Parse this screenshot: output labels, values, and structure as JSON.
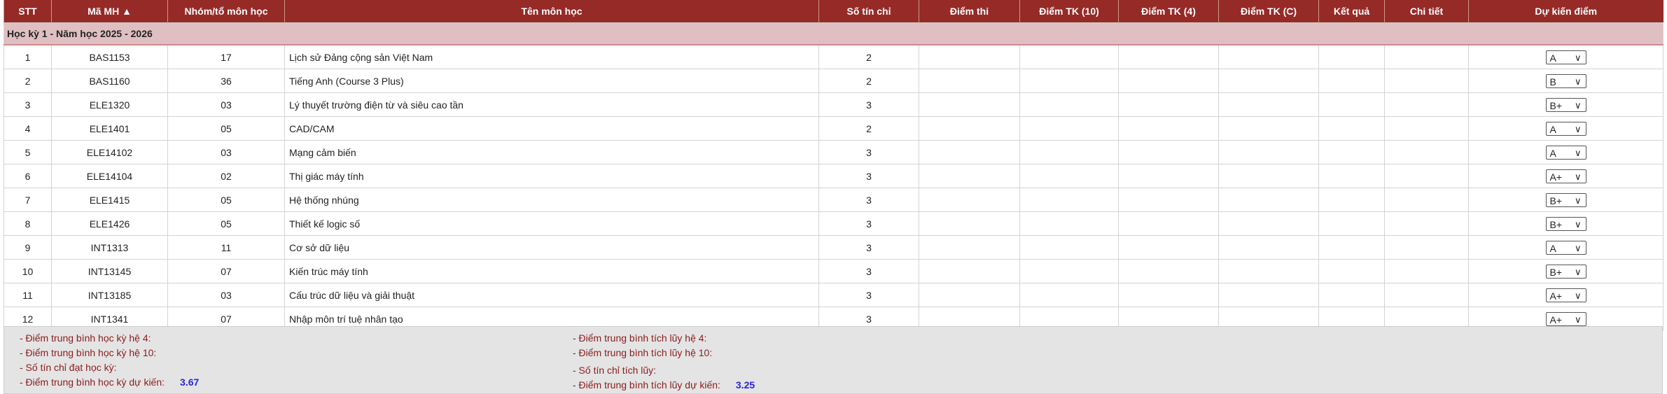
{
  "table": {
    "headers": [
      "STT",
      "Mã MH ▲",
      "Nhóm/tổ môn học",
      "Tên môn học",
      "Số tín chỉ",
      "Điểm thi",
      "Điểm TK (10)",
      "Điểm TK (4)",
      "Điểm TK (C)",
      "Kết quả",
      "Chi tiết",
      "Dự kiến điểm"
    ],
    "group_label": "Học kỳ 1 - Năm học 2025 - 2026",
    "rows": [
      {
        "stt": "1",
        "code": "BAS1153",
        "group": "17",
        "name": "Lịch sử Đảng cộng sản Việt Nam",
        "credits": "2",
        "predicted": "A"
      },
      {
        "stt": "2",
        "code": "BAS1160",
        "group": "36",
        "name": "Tiếng Anh (Course 3 Plus)",
        "credits": "2",
        "predicted": "B"
      },
      {
        "stt": "3",
        "code": "ELE1320",
        "group": "03",
        "name": "Lý thuyết trường điện từ và siêu cao tần",
        "credits": "3",
        "predicted": "B+"
      },
      {
        "stt": "4",
        "code": "ELE1401",
        "group": "05",
        "name": "CAD/CAM",
        "credits": "2",
        "predicted": "A"
      },
      {
        "stt": "5",
        "code": "ELE14102",
        "group": "03",
        "name": "Mạng cảm biến",
        "credits": "3",
        "predicted": "A"
      },
      {
        "stt": "6",
        "code": "ELE14104",
        "group": "02",
        "name": "Thị giác máy tính",
        "credits": "3",
        "predicted": "A+"
      },
      {
        "stt": "7",
        "code": "ELE1415",
        "group": "05",
        "name": "Hệ thống nhúng",
        "credits": "3",
        "predicted": "B+"
      },
      {
        "stt": "8",
        "code": "ELE1426",
        "group": "05",
        "name": "Thiết kế logic số",
        "credits": "3",
        "predicted": "B+"
      },
      {
        "stt": "9",
        "code": "INT1313",
        "group": "11",
        "name": "Cơ sở dữ liệu",
        "credits": "3",
        "predicted": "A"
      },
      {
        "stt": "10",
        "code": "INT13145",
        "group": "07",
        "name": "Kiến trúc máy tính",
        "credits": "3",
        "predicted": "B+"
      },
      {
        "stt": "11",
        "code": "INT13185",
        "group": "03",
        "name": "Cấu trúc dữ liệu và giải thuật",
        "credits": "3",
        "predicted": "A+"
      },
      {
        "stt": "12",
        "code": "INT1341",
        "group": "07",
        "name": "Nhập môn trí tuệ nhân tạo",
        "credits": "3",
        "predicted": "A+"
      }
    ]
  },
  "summary": {
    "left": [
      {
        "label": "- Điểm trung bình học kỳ hệ 4:",
        "value": ""
      },
      {
        "label": "- Điểm trung bình học kỳ hệ 10:",
        "value": ""
      },
      {
        "label": "- Số tín chỉ đạt học kỳ:",
        "value": ""
      },
      {
        "label": "- Điểm trung bình học kỳ dự kiến:",
        "value": "3.67"
      }
    ],
    "right": [
      {
        "label": "- Điểm trung bình tích lũy hệ 4:",
        "value": ""
      },
      {
        "label": "- Điểm trung bình tích lũy hệ 10:",
        "value": ""
      },
      {
        "label": "- Số tín chỉ tích lũy:",
        "value": ""
      },
      {
        "label": "- Điểm trung bình tích lũy dự kiến:",
        "value": "3.25"
      }
    ]
  },
  "colors": {
    "header": "#962a27",
    "group": "#dfbfc1",
    "footer": "#e4e4e4",
    "footer_text": "#8b1c1c",
    "value": "#2424ee"
  }
}
